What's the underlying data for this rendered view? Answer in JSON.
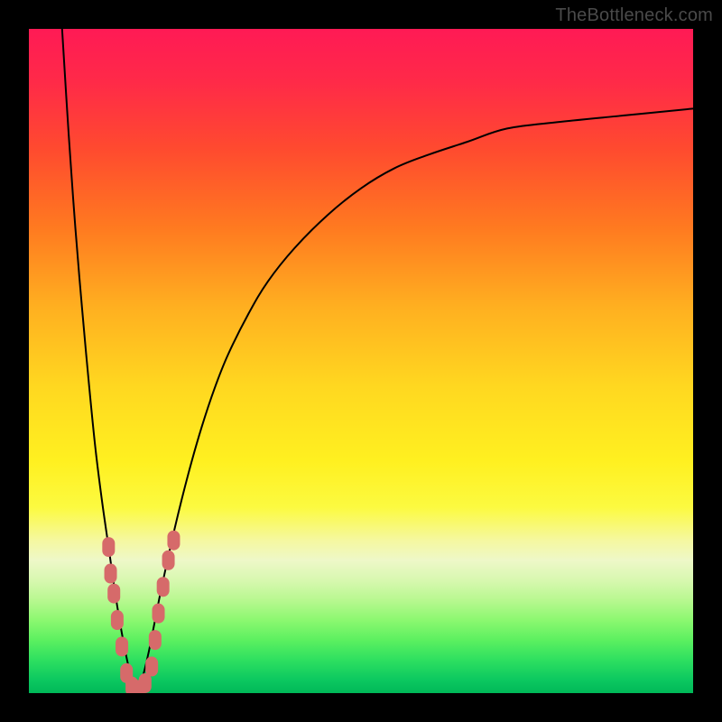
{
  "watermark": "TheBottleneck.com",
  "colors": {
    "frame": "#000000",
    "curve": "#000000",
    "marker": "#d66a6a",
    "gradient_stops": [
      "#ff1a55",
      "#ff2a48",
      "#ff4a2f",
      "#ff7a20",
      "#ffb020",
      "#ffd820",
      "#fff020",
      "#fcfa40",
      "#f5f8a0",
      "#eef8c8",
      "#d8f8b0",
      "#b8f890",
      "#8cf870",
      "#5cf060",
      "#2ee060",
      "#0cc860",
      "#00b858"
    ]
  },
  "chart_data": {
    "type": "line",
    "title": "",
    "xlabel": "",
    "ylabel": "",
    "xlim": [
      0,
      100
    ],
    "ylim": [
      0,
      100
    ],
    "grid": false,
    "legend": false,
    "series": [
      {
        "name": "bottleneck-curve",
        "description": "V-shaped bottleneck curve. Minimum around x≈16 at y≈0; left branch shoots to y≈100 near x≈5; right branch rises and asymptotically flattens toward y≈88 by x≈100.",
        "x": [
          5,
          6,
          7,
          8,
          9,
          10,
          11,
          12,
          13,
          14,
          15,
          16,
          17,
          18,
          19,
          20,
          22,
          24,
          26,
          28,
          30,
          33,
          36,
          40,
          45,
          50,
          55,
          60,
          66,
          72,
          80,
          90,
          100
        ],
        "y": [
          100,
          84,
          70,
          58,
          47,
          37,
          29,
          22,
          15,
          9,
          4,
          0,
          2,
          6,
          11,
          16,
          25,
          33,
          40,
          46,
          51,
          57,
          62,
          67,
          72,
          76,
          79,
          81,
          83,
          85,
          86,
          87,
          88
        ]
      }
    ],
    "markers": {
      "name": "data-points",
      "shape": "rounded-lozenge",
      "color": "#d66a6a",
      "points": [
        {
          "x": 12.0,
          "y": 22
        },
        {
          "x": 12.3,
          "y": 18
        },
        {
          "x": 12.8,
          "y": 15
        },
        {
          "x": 13.3,
          "y": 11
        },
        {
          "x": 14.0,
          "y": 7
        },
        {
          "x": 14.7,
          "y": 3
        },
        {
          "x": 15.5,
          "y": 1
        },
        {
          "x": 16.5,
          "y": 0.5
        },
        {
          "x": 17.5,
          "y": 1.5
        },
        {
          "x": 18.5,
          "y": 4
        },
        {
          "x": 19.0,
          "y": 8
        },
        {
          "x": 19.5,
          "y": 12
        },
        {
          "x": 20.2,
          "y": 16
        },
        {
          "x": 21.0,
          "y": 20
        },
        {
          "x": 21.8,
          "y": 23
        }
      ]
    }
  }
}
